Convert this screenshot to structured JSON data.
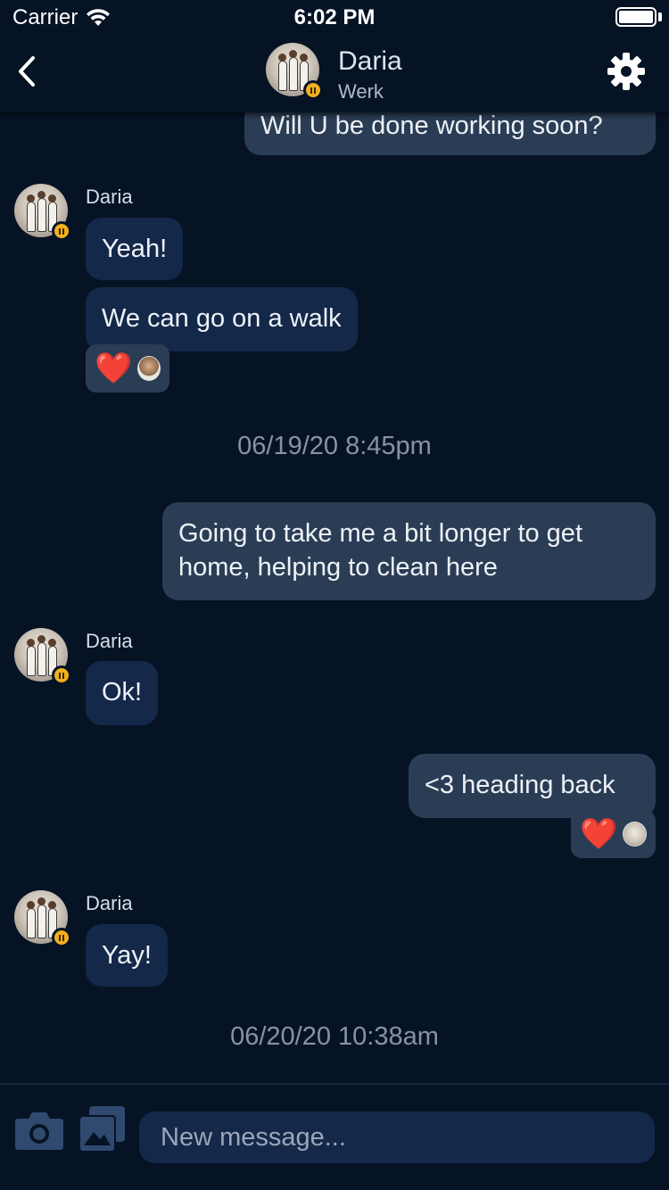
{
  "status_bar": {
    "carrier": "Carrier",
    "time": "6:02 PM"
  },
  "header": {
    "name": "Daria",
    "status": "Werk"
  },
  "messages": [
    {
      "type": "outgoing",
      "text": "Will U be done working soon?"
    },
    {
      "type": "incoming",
      "sender": "Daria",
      "text": "Yeah!"
    },
    {
      "type": "incoming",
      "text": "We can go on a walk",
      "reaction": "❤️"
    },
    {
      "type": "timestamp",
      "text": "06/19/20 8:45pm"
    },
    {
      "type": "outgoing",
      "text_line1": "Going to take me a bit longer to get",
      "text_line2": "home, helping to clean here"
    },
    {
      "type": "incoming",
      "sender": "Daria",
      "text": "Ok!"
    },
    {
      "type": "outgoing",
      "text": "<3 heading back",
      "reaction": "❤️"
    },
    {
      "type": "incoming",
      "sender": "Daria",
      "text": "Yay!"
    },
    {
      "type": "timestamp",
      "text": "06/20/20 10:38am"
    }
  ],
  "compose": {
    "placeholder": "New message..."
  },
  "colors": {
    "background": "#061325",
    "incoming_bubble": "#14284a",
    "outgoing_bubble": "#2b3d55",
    "status_badge": "#f2b01e",
    "heart": "#e2202e"
  },
  "icons": [
    "wifi-icon",
    "battery-icon",
    "back-chevron-icon",
    "gear-icon",
    "camera-icon",
    "photo-gallery-icon",
    "heart-icon",
    "pause-badge-icon"
  ]
}
